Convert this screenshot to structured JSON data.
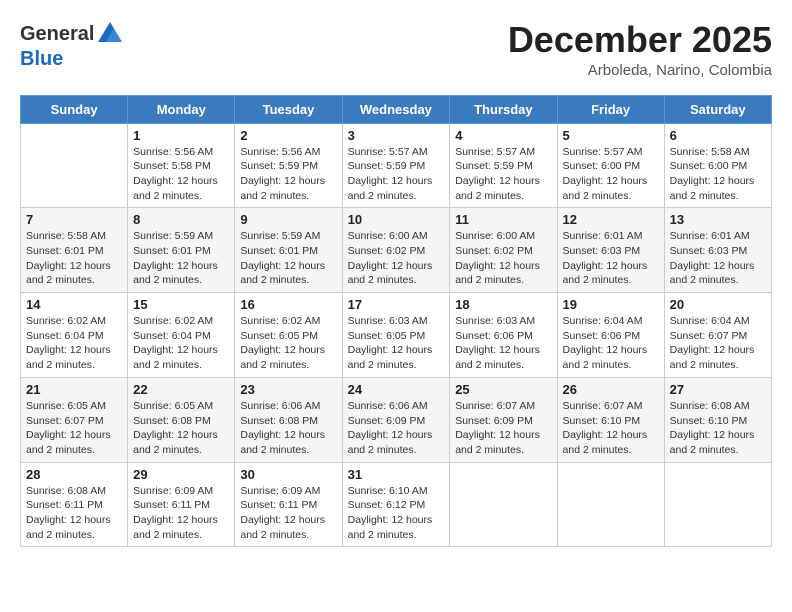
{
  "header": {
    "logo_general": "General",
    "logo_blue": "Blue",
    "title": "December 2025",
    "subtitle": "Arboleda, Narino, Colombia"
  },
  "calendar": {
    "days_of_week": [
      "Sunday",
      "Monday",
      "Tuesday",
      "Wednesday",
      "Thursday",
      "Friday",
      "Saturday"
    ],
    "weeks": [
      [
        {
          "day": "",
          "info": ""
        },
        {
          "day": "1",
          "info": "Sunrise: 5:56 AM\nSunset: 5:58 PM\nDaylight: 12 hours\nand 2 minutes."
        },
        {
          "day": "2",
          "info": "Sunrise: 5:56 AM\nSunset: 5:59 PM\nDaylight: 12 hours\nand 2 minutes."
        },
        {
          "day": "3",
          "info": "Sunrise: 5:57 AM\nSunset: 5:59 PM\nDaylight: 12 hours\nand 2 minutes."
        },
        {
          "day": "4",
          "info": "Sunrise: 5:57 AM\nSunset: 5:59 PM\nDaylight: 12 hours\nand 2 minutes."
        },
        {
          "day": "5",
          "info": "Sunrise: 5:57 AM\nSunset: 6:00 PM\nDaylight: 12 hours\nand 2 minutes."
        },
        {
          "day": "6",
          "info": "Sunrise: 5:58 AM\nSunset: 6:00 PM\nDaylight: 12 hours\nand 2 minutes."
        }
      ],
      [
        {
          "day": "7",
          "info": "Sunrise: 5:58 AM\nSunset: 6:01 PM\nDaylight: 12 hours\nand 2 minutes."
        },
        {
          "day": "8",
          "info": "Sunrise: 5:59 AM\nSunset: 6:01 PM\nDaylight: 12 hours\nand 2 minutes."
        },
        {
          "day": "9",
          "info": "Sunrise: 5:59 AM\nSunset: 6:01 PM\nDaylight: 12 hours\nand 2 minutes."
        },
        {
          "day": "10",
          "info": "Sunrise: 6:00 AM\nSunset: 6:02 PM\nDaylight: 12 hours\nand 2 minutes."
        },
        {
          "day": "11",
          "info": "Sunrise: 6:00 AM\nSunset: 6:02 PM\nDaylight: 12 hours\nand 2 minutes."
        },
        {
          "day": "12",
          "info": "Sunrise: 6:01 AM\nSunset: 6:03 PM\nDaylight: 12 hours\nand 2 minutes."
        },
        {
          "day": "13",
          "info": "Sunrise: 6:01 AM\nSunset: 6:03 PM\nDaylight: 12 hours\nand 2 minutes."
        }
      ],
      [
        {
          "day": "14",
          "info": "Sunrise: 6:02 AM\nSunset: 6:04 PM\nDaylight: 12 hours\nand 2 minutes."
        },
        {
          "day": "15",
          "info": "Sunrise: 6:02 AM\nSunset: 6:04 PM\nDaylight: 12 hours\nand 2 minutes."
        },
        {
          "day": "16",
          "info": "Sunrise: 6:02 AM\nSunset: 6:05 PM\nDaylight: 12 hours\nand 2 minutes."
        },
        {
          "day": "17",
          "info": "Sunrise: 6:03 AM\nSunset: 6:05 PM\nDaylight: 12 hours\nand 2 minutes."
        },
        {
          "day": "18",
          "info": "Sunrise: 6:03 AM\nSunset: 6:06 PM\nDaylight: 12 hours\nand 2 minutes."
        },
        {
          "day": "19",
          "info": "Sunrise: 6:04 AM\nSunset: 6:06 PM\nDaylight: 12 hours\nand 2 minutes."
        },
        {
          "day": "20",
          "info": "Sunrise: 6:04 AM\nSunset: 6:07 PM\nDaylight: 12 hours\nand 2 minutes."
        }
      ],
      [
        {
          "day": "21",
          "info": "Sunrise: 6:05 AM\nSunset: 6:07 PM\nDaylight: 12 hours\nand 2 minutes."
        },
        {
          "day": "22",
          "info": "Sunrise: 6:05 AM\nSunset: 6:08 PM\nDaylight: 12 hours\nand 2 minutes."
        },
        {
          "day": "23",
          "info": "Sunrise: 6:06 AM\nSunset: 6:08 PM\nDaylight: 12 hours\nand 2 minutes."
        },
        {
          "day": "24",
          "info": "Sunrise: 6:06 AM\nSunset: 6:09 PM\nDaylight: 12 hours\nand 2 minutes."
        },
        {
          "day": "25",
          "info": "Sunrise: 6:07 AM\nSunset: 6:09 PM\nDaylight: 12 hours\nand 2 minutes."
        },
        {
          "day": "26",
          "info": "Sunrise: 6:07 AM\nSunset: 6:10 PM\nDaylight: 12 hours\nand 2 minutes."
        },
        {
          "day": "27",
          "info": "Sunrise: 6:08 AM\nSunset: 6:10 PM\nDaylight: 12 hours\nand 2 minutes."
        }
      ],
      [
        {
          "day": "28",
          "info": "Sunrise: 6:08 AM\nSunset: 6:11 PM\nDaylight: 12 hours\nand 2 minutes."
        },
        {
          "day": "29",
          "info": "Sunrise: 6:09 AM\nSunset: 6:11 PM\nDaylight: 12 hours\nand 2 minutes."
        },
        {
          "day": "30",
          "info": "Sunrise: 6:09 AM\nSunset: 6:11 PM\nDaylight: 12 hours\nand 2 minutes."
        },
        {
          "day": "31",
          "info": "Sunrise: 6:10 AM\nSunset: 6:12 PM\nDaylight: 12 hours\nand 2 minutes."
        },
        {
          "day": "",
          "info": ""
        },
        {
          "day": "",
          "info": ""
        },
        {
          "day": "",
          "info": ""
        }
      ]
    ]
  }
}
